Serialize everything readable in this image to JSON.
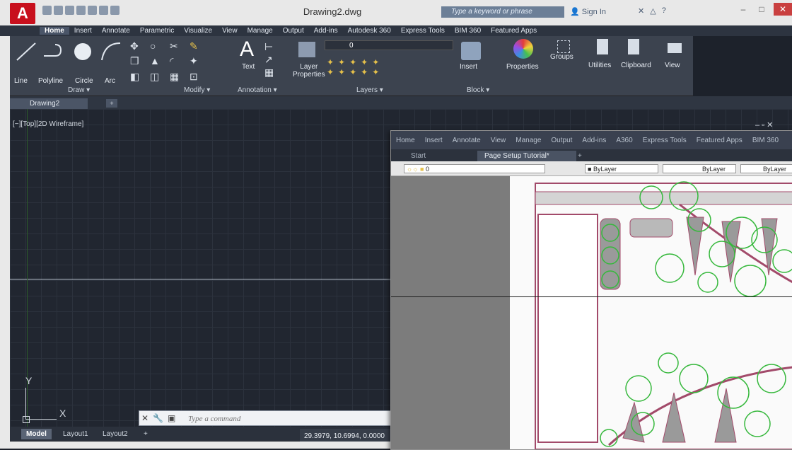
{
  "window": {
    "title": "Drawing2.dwg",
    "app_letter": "A",
    "search_placeholder": "Type a keyword or phrase",
    "signin_label": "Sign In",
    "help_label": "?",
    "minimize": "–",
    "maximize": "□",
    "close": "✕"
  },
  "ribbon_tabs": [
    "Home",
    "Insert",
    "Annotate",
    "Parametric",
    "Visualize",
    "View",
    "Manage",
    "Output",
    "Add-ins",
    "Autodesk 360",
    "Express Tools",
    "BIM 360",
    "Featured Apps"
  ],
  "ribbon": {
    "draw": {
      "line": "Line",
      "polyline": "Polyline",
      "circle": "Circle",
      "arc": "Arc",
      "title": "Draw ▾"
    },
    "modify": {
      "title": "Modify ▾"
    },
    "annotation": {
      "text": "Text",
      "title": "Annotation ▾"
    },
    "layers": {
      "layer_properties": "Layer\nProperties",
      "title": "Layers ▾",
      "current_layer": "0"
    },
    "block": {
      "insert": "Insert",
      "title": "Block ▾"
    },
    "properties": {
      "label": "Properties"
    },
    "groups": {
      "label": "Groups"
    },
    "utilities": {
      "label": "Utilities"
    },
    "clipboard": {
      "label": "Clipboard"
    },
    "view": {
      "label": "View"
    }
  },
  "doc_tabs": {
    "active": "Drawing2",
    "plus": "+"
  },
  "viewport": {
    "label": "[−][Top][2D Wireframe]",
    "controls": "– ▫ ✕"
  },
  "ucs": {
    "x": "X",
    "y": "Y"
  },
  "command": {
    "placeholder": "Type a command"
  },
  "layout_tabs": [
    "Model",
    "Layout1",
    "Layout2"
  ],
  "layout_plus": "+",
  "coordinates": "29.3979, 10.6994, 0.0000",
  "inset": {
    "menu": [
      "Home",
      "Insert",
      "Annotate",
      "View",
      "Manage",
      "Output",
      "Add-ins",
      "A360",
      "Express Tools",
      "Featured Apps",
      "BIM 360"
    ],
    "tabs": [
      "Start",
      "Page Setup Tutorial*"
    ],
    "tab_plus": "+",
    "layer": "0",
    "color": "ByLayer",
    "linetype": "ByLayer",
    "lineweight": "ByLayer"
  }
}
